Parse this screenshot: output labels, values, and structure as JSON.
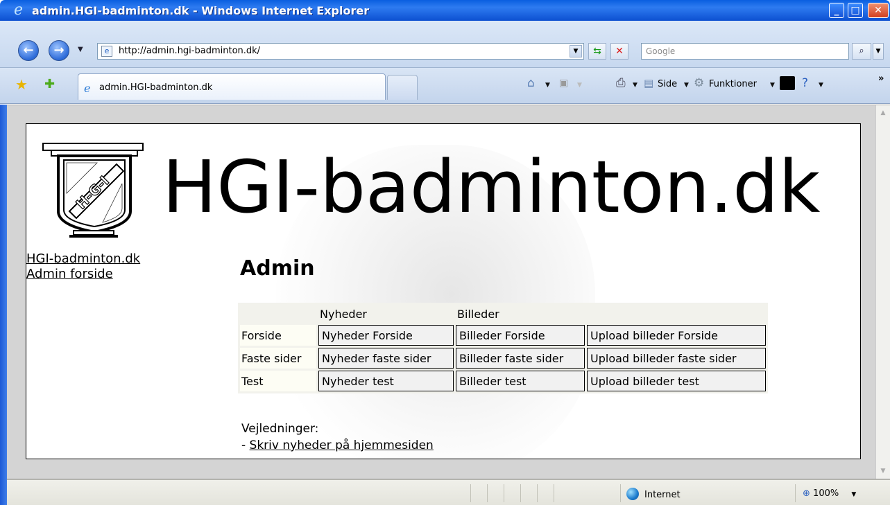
{
  "window": {
    "title": "admin.HGI-badminton.dk - Windows Internet Explorer",
    "minimize_glyph": "_",
    "maximize_glyph": "□",
    "close_glyph": "✕"
  },
  "addressbar": {
    "url": "http://admin.hgi-badminton.dk/",
    "search_placeholder": "Google"
  },
  "tabs": [
    {
      "label": "admin.HGI-badminton.dk",
      "active": true
    }
  ],
  "commandbar": {
    "page_label": "Side",
    "tools_label": "Funktioner",
    "more_glyph": "»"
  },
  "page": {
    "site_title": "HGI-badminton.dk",
    "logo_text": "H-G-I",
    "nav_links": [
      "HGI-badminton.dk",
      "Admin forside"
    ],
    "heading": "Admin",
    "table": {
      "headers": [
        "",
        "Nyheder",
        "Billeder",
        ""
      ],
      "rows": [
        {
          "label": "Forside",
          "cells": [
            "Nyheder Forside",
            "Billeder Forside",
            "Upload billeder Forside"
          ]
        },
        {
          "label": "Faste sider",
          "cells": [
            "Nyheder faste sider",
            "Billeder faste sider",
            "Upload billeder faste sider"
          ]
        },
        {
          "label": "Test",
          "cells": [
            "Nyheder test",
            "Billeder test",
            "Upload billeder test"
          ]
        }
      ]
    },
    "guides_label": "Vejledninger:",
    "guides_prefix": "- ",
    "guides_link": "Skriv nyheder på hjemmesiden"
  },
  "statusbar": {
    "zone": "Internet",
    "zoom": "100%"
  },
  "colors": {
    "titlebar": "#1c64e0",
    "content_border": "#000000",
    "table_bg": "#f2f2ec"
  }
}
